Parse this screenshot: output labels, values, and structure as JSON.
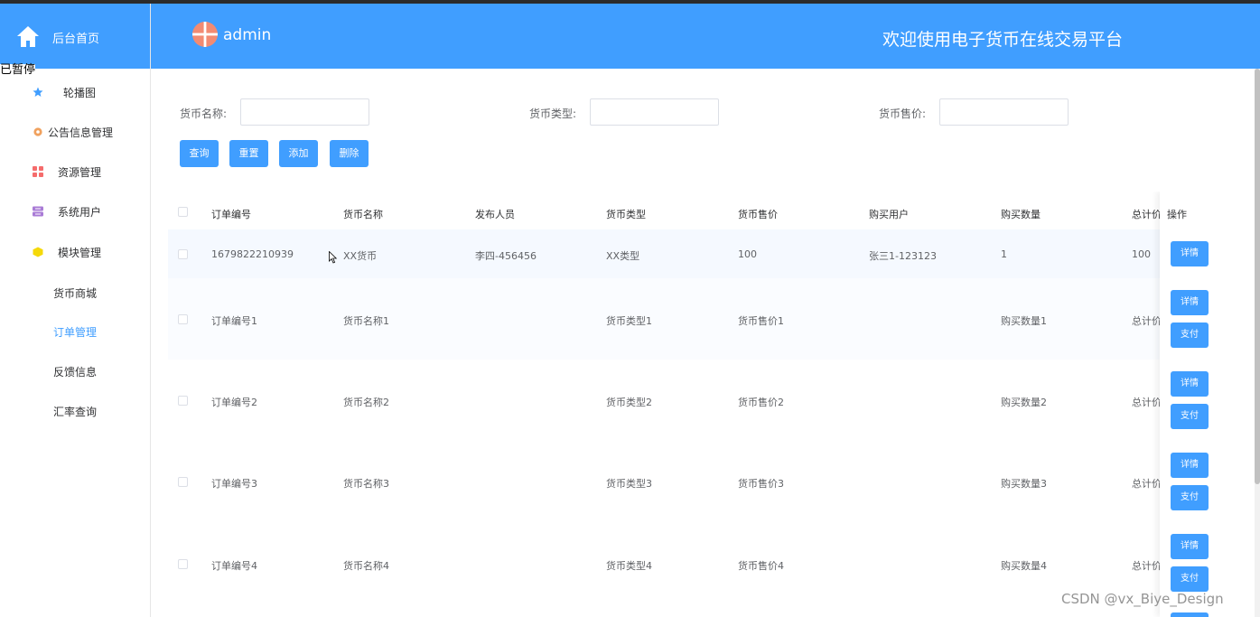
{
  "sidebar": {
    "header_label": "后台首页",
    "tip_text": "已暂停",
    "items": [
      {
        "label": "轮播图",
        "icon": "star-icon",
        "color": "#409eff"
      },
      {
        "label": "公告信息管理",
        "icon": "gear-icon",
        "color": "#f0a15e"
      },
      {
        "label": "资源管理",
        "icon": "grid-icon",
        "color": "#f56c6c"
      },
      {
        "label": "系统用户",
        "icon": "server-icon",
        "color": "#a97bd6"
      },
      {
        "label": "模块管理",
        "icon": "cube-icon",
        "color": "#f5d90a"
      }
    ],
    "sub_items": [
      {
        "label": "货币商城"
      },
      {
        "label": "订单管理"
      },
      {
        "label": "反馈信息"
      },
      {
        "label": "汇率查询"
      }
    ]
  },
  "header": {
    "user": "admin",
    "title": "欢迎使用电子货币在线交易平台"
  },
  "filters": {
    "name_label": "货币名称:",
    "type_label": "货币类型:",
    "price_label": "货币售价:"
  },
  "buttons": {
    "query": "查询",
    "reset": "重置",
    "add": "添加",
    "delete": "删除"
  },
  "table": {
    "columns": [
      "订单编号",
      "货币名称",
      "发布人员",
      "货币类型",
      "货币售价",
      "购买用户",
      "购买数量",
      "总计价"
    ],
    "op_column": "操作",
    "rows": [
      {
        "order_no": "1679822210939",
        "coin_name": "XX货币",
        "publisher": "李四-456456",
        "coin_type": "XX类型",
        "price": "100",
        "buyer": "张三1-123123",
        "qty": "1",
        "total": "100"
      },
      {
        "order_no": "订单编号1",
        "coin_name": "货币名称1",
        "publisher": "",
        "coin_type": "货币类型1",
        "price": "货币售价1",
        "buyer": "",
        "qty": "购买数量1",
        "total": "总计价"
      },
      {
        "order_no": "订单编号2",
        "coin_name": "货币名称2",
        "publisher": "",
        "coin_type": "货币类型2",
        "price": "货币售价2",
        "buyer": "",
        "qty": "购买数量2",
        "total": "总计价"
      },
      {
        "order_no": "订单编号3",
        "coin_name": "货币名称3",
        "publisher": "",
        "coin_type": "货币类型3",
        "price": "货币售价3",
        "buyer": "",
        "qty": "购买数量3",
        "total": "总计价"
      },
      {
        "order_no": "订单编号4",
        "coin_name": "货币名称4",
        "publisher": "",
        "coin_type": "货币类型4",
        "price": "货币售价4",
        "buyer": "",
        "qty": "购买数量4",
        "total": "总计价"
      }
    ],
    "detail_label": "详情",
    "pay_label": "支付"
  },
  "watermark": "CSDN @vx_Biye_Design",
  "colors": {
    "primary": "#409eff",
    "active_text": "#409eff"
  }
}
